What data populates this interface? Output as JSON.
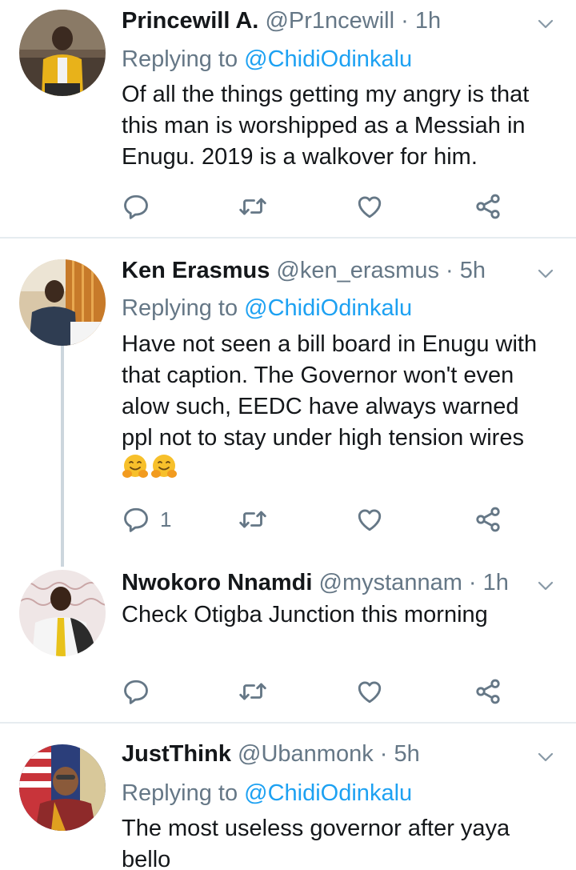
{
  "tweets": [
    {
      "name": "Princewill A.",
      "handle": "@Pr1ncewill",
      "dot": "·",
      "time": "1h",
      "replying_prefix": "Replying to ",
      "replying_to": "@ChidiOdinkalu",
      "text": "Of all the things getting my angry is that this man is worshipped as a Messiah in Enugu. 2019 is a walkover for him.",
      "reply_count": ""
    },
    {
      "name": "Ken Erasmus",
      "handle": "@ken_erasmus",
      "dot": "·",
      "time": "5h",
      "replying_prefix": "Replying to ",
      "replying_to": "@ChidiOdinkalu",
      "text": "Have not seen a bill board in Enugu with that caption. The Governor won't even alow such, EEDC have always warned ppl not to stay under high tension wires",
      "emojis": [
        "🤗",
        "🤗"
      ],
      "reply_count": "1"
    },
    {
      "name": "Nwokoro Nnamdi",
      "handle": "@mystannam",
      "dot": "·",
      "time": "1h",
      "text": "Check Otigba Junction this morning",
      "reply_count": ""
    },
    {
      "name": "JustThink",
      "handle": "@Ubanmonk",
      "dot": "·",
      "time": "5h",
      "replying_prefix": "Replying to ",
      "replying_to": "@ChidiOdinkalu",
      "text": "The most useless governor after yaya bello"
    }
  ],
  "icons": {
    "reply": "reply-icon",
    "retweet": "retweet-icon",
    "like": "heart-icon",
    "share": "share-icon",
    "menu": "chevron-down-icon"
  },
  "colors": {
    "name": "#14171a",
    "secondary": "#657786",
    "mention": "#1da1f2",
    "divider": "#e6ecf0",
    "thread_line": "#ccd6dd"
  }
}
